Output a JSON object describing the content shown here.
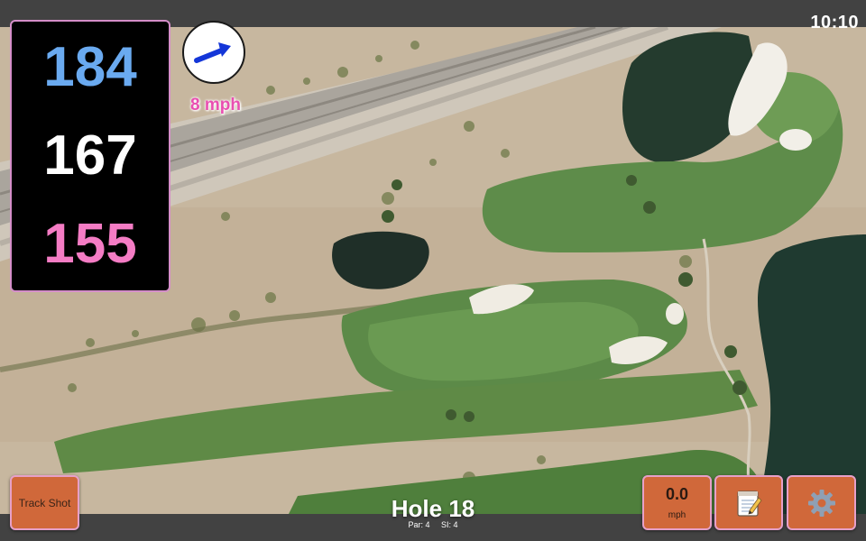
{
  "status_bar": {
    "time": "10:10"
  },
  "distances": {
    "back": "184",
    "middle": "167",
    "front": "155",
    "colors": {
      "back": "#6aaaf0",
      "middle": "#ffffff",
      "front": "#f47cc4"
    }
  },
  "wind": {
    "speed_label": "8 mph",
    "icon": "wind-direction-arrow-icon"
  },
  "controls": {
    "track_shot_label": "Track Shot",
    "wind_value": "0.0",
    "wind_unit": "mph",
    "notes_icon": "notepad-icon",
    "settings_icon": "gear-icon",
    "accent_color": "#d0683a"
  },
  "hole": {
    "title": "Hole 18",
    "par_label": "Par: 4",
    "si_label": "SI: 4"
  }
}
